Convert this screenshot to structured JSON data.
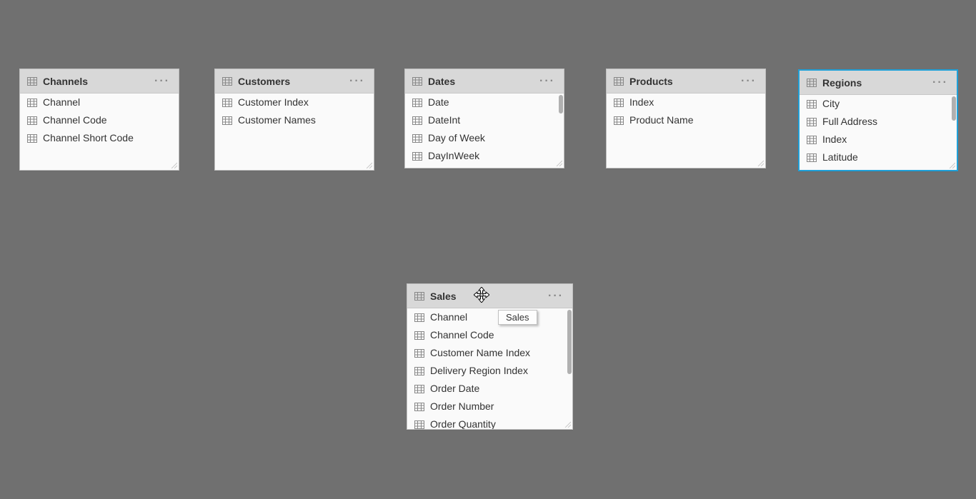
{
  "tooltip": "Sales",
  "tables": {
    "channels": {
      "title": "Channels",
      "fields": [
        "Channel",
        "Channel Code",
        "Channel Short Code"
      ]
    },
    "customers": {
      "title": "Customers",
      "fields": [
        "Customer Index",
        "Customer Names"
      ]
    },
    "dates": {
      "title": "Dates",
      "fields": [
        "Date",
        "DateInt",
        "Day of Week",
        "DayInWeek"
      ]
    },
    "products": {
      "title": "Products",
      "fields": [
        "Index",
        "Product Name"
      ]
    },
    "regions": {
      "title": "Regions",
      "fields": [
        "City",
        "Full Address",
        "Index",
        "Latitude"
      ]
    },
    "sales": {
      "title": "Sales",
      "fields": [
        "Channel",
        "Channel Code",
        "Customer Name Index",
        "Delivery Region Index",
        "Order Date",
        "Order Number",
        "Order Quantity"
      ]
    }
  }
}
